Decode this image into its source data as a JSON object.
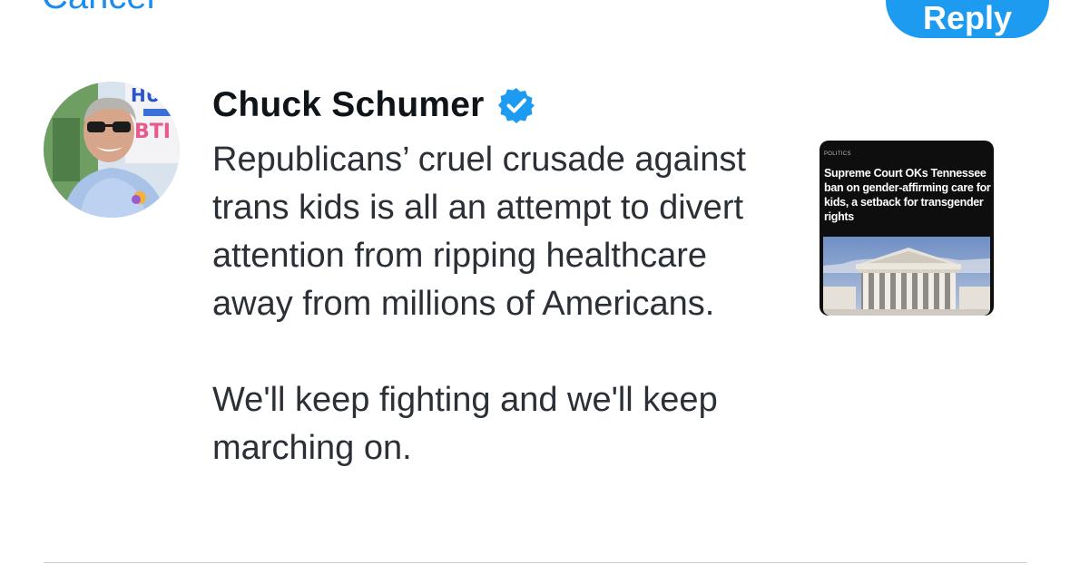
{
  "header": {
    "cancel_label": "Cancel",
    "reply_label": "Reply"
  },
  "tweet": {
    "author_name": "Chuck Schumer",
    "verified": true,
    "paragraphs": [
      "Republicans’ cruel crusade against trans kids is all an attempt to divert attention from ripping healthcare away from millions of Americans.",
      "We'll keep fighting and we'll keep marching on."
    ]
  },
  "link_card": {
    "kicker": "POLITICS",
    "headline": "Supreme Court OKs Tennessee ban on gender-affirming care for kids, a setback for transgender rights"
  },
  "colors": {
    "accent": "#1d9bf0",
    "text": "#2b2f36",
    "name": "#0f1419",
    "divider": "#c9ced3"
  },
  "icons": {
    "verified": "verified-check-badge"
  }
}
